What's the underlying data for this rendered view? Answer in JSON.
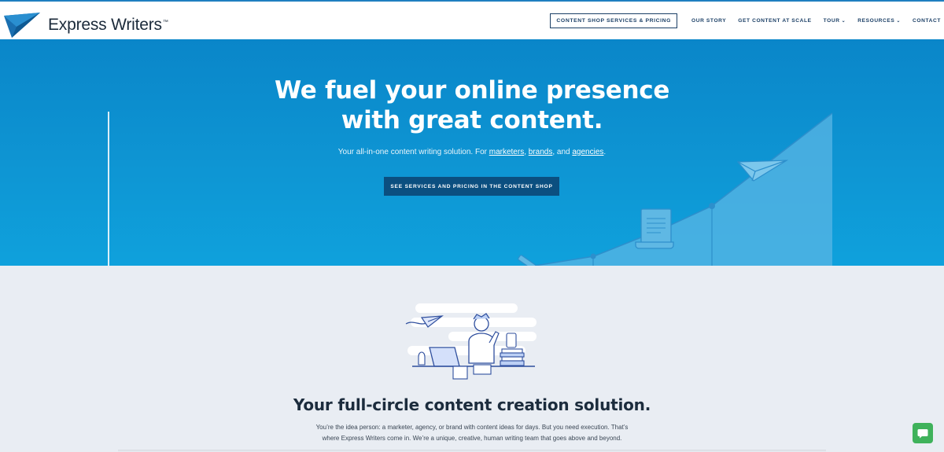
{
  "brand": {
    "name": "Express Writers",
    "tm": "™"
  },
  "nav": {
    "cta": "CONTENT SHOP SERVICES & PRICING",
    "items": [
      {
        "label": "OUR STORY",
        "caret": ""
      },
      {
        "label": "GET CONTENT AT SCALE",
        "caret": ""
      },
      {
        "label": "TOUR",
        "caret": "⌄"
      },
      {
        "label": "RESOURCES",
        "caret": "⌄"
      },
      {
        "label": "CONTACT",
        "caret": ""
      }
    ]
  },
  "hero": {
    "title_line1": "We fuel your online presence",
    "title_line2": "with great content.",
    "sub_before": "Your all-in-one content writing solution. For ",
    "link_marketers": "marketers",
    "sep1": ", ",
    "link_brands": "brands",
    "sep2": ", and ",
    "link_agencies": "agencies",
    "sub_after": ".",
    "button": "SEE SERVICES AND PRICING IN THE CONTENT SHOP"
  },
  "section": {
    "title": "Your full-circle content creation solution.",
    "body": "You’re the idea person: a marketer, agency, or brand with content ideas for days. But you need execution. That’s where Express Writers come in. We’re a unique, creative, human writing team that goes above and beyond."
  },
  "icons": {
    "logo": "paper-plane-logo-icon",
    "chat": "chat-bubble-icon",
    "paper_plane": "paper-plane-icon",
    "scroll": "document-scroll-icon",
    "pencil": "pencil-icon"
  },
  "colors": {
    "hero_top": "#0a86c9",
    "hero_bottom": "#0fa1dc",
    "button_dark": "#0b4f80",
    "nav_text": "#1b3f66",
    "chat_green": "#3fb25b"
  }
}
